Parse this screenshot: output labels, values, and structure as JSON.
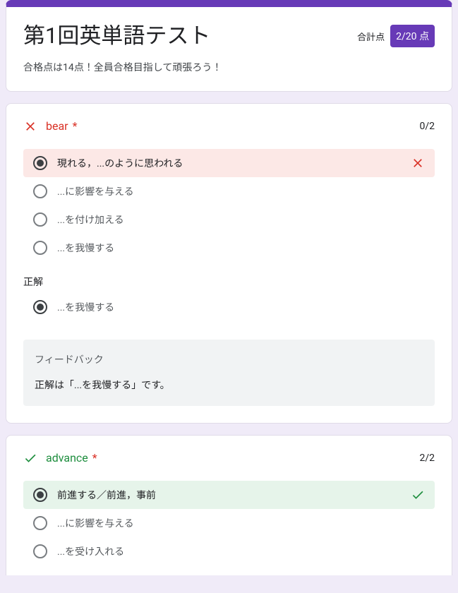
{
  "header": {
    "title": "第1回英単語テスト",
    "score_label": "合計点",
    "score_value": "2/20 点",
    "description": "合格点は14点！全員合格目指して頑張ろう！"
  },
  "q1": {
    "word": "bear",
    "required": "*",
    "points": "0/2",
    "options": [
      {
        "label": "現れる，...のように思われる"
      },
      {
        "label": "...に影響を与える"
      },
      {
        "label": "...を付け加える"
      },
      {
        "label": "...を我慢する"
      }
    ],
    "correct_label": "正解",
    "correct_answer": "...を我慢する",
    "feedback_title": "フィードバック",
    "feedback_body": "正解は「...を我慢する」です。"
  },
  "q2": {
    "word": "advance",
    "required": "*",
    "points": "2/2",
    "options": [
      {
        "label": "前進する／前進，事前"
      },
      {
        "label": "...に影響を与える"
      },
      {
        "label": "...を受け入れる"
      }
    ]
  }
}
